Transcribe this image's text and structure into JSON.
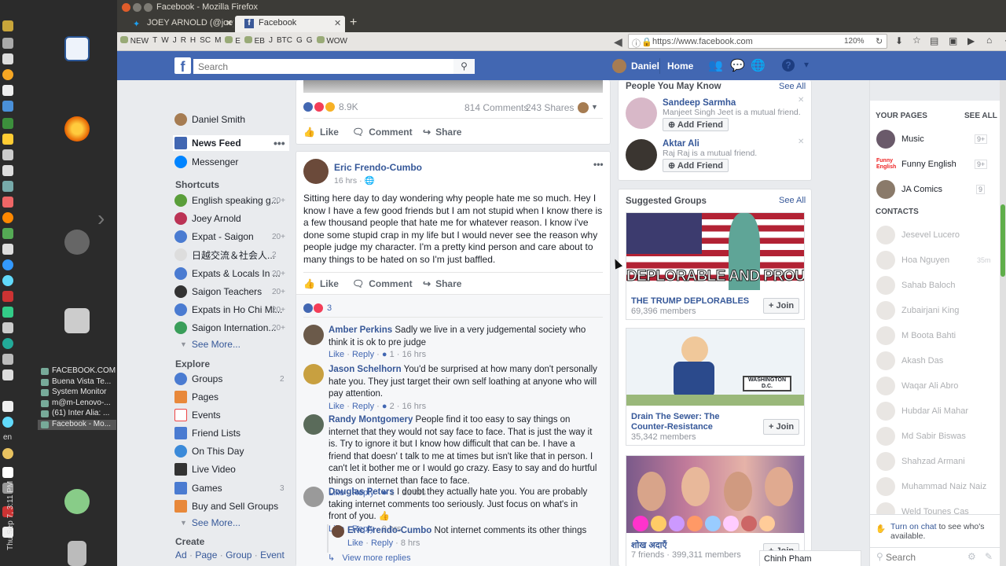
{
  "os": {
    "time": "Thu Sep 7, 3:11 PM",
    "lang": "en",
    "task_windows": [
      "FACEBOOK.COM",
      "Buena Vista Te...",
      "System Monitor",
      "m@m-Lenovo-...",
      "(61) Inter Alia: ...",
      "Facebook - Mo..."
    ]
  },
  "browser": {
    "title": "Facebook - Mozilla Firefox",
    "tabs": [
      {
        "label": "JOEY ARNOLD (@joey..."
      },
      {
        "label": "Facebook"
      }
    ],
    "new_tab": "+",
    "bookmarks": [
      "NEW",
      "T",
      "W",
      "J",
      "R",
      "H",
      "SC",
      "M",
      "E",
      "EB",
      "J",
      "BTC",
      "G",
      "G",
      "WOW"
    ],
    "url": "https://www.facebook.com",
    "zoom": "120%"
  },
  "fb": {
    "logo": "f",
    "search_placeholder": "Search",
    "user_first": "Daniel",
    "home": "Home"
  },
  "leftnav": {
    "user": "Daniel Smith",
    "news_feed": "News Feed",
    "messenger": "Messenger",
    "shortcuts_title": "Shortcuts",
    "shortcuts": [
      {
        "label": "English speaking g...",
        "count": "20+"
      },
      {
        "label": "Joey Arnold",
        "count": ""
      },
      {
        "label": "Expat - Saigon",
        "count": "20+"
      },
      {
        "label": "日越交流＆社会人...",
        "count": "2"
      },
      {
        "label": "Expats & Locals In ...",
        "count": "20+"
      },
      {
        "label": "Saigon Teachers",
        "count": "20+"
      },
      {
        "label": "Expats in Ho Chi Mi...",
        "count": "20+"
      },
      {
        "label": "Saigon Internation...",
        "count": "20+"
      }
    ],
    "see_more": "See More...",
    "explore_title": "Explore",
    "explore": [
      {
        "label": "Groups",
        "count": "2"
      },
      {
        "label": "Pages",
        "count": ""
      },
      {
        "label": "Events",
        "count": ""
      },
      {
        "label": "Friend Lists",
        "count": ""
      },
      {
        "label": "On This Day",
        "count": ""
      },
      {
        "label": "Live Video",
        "count": ""
      },
      {
        "label": "Games",
        "count": "3"
      },
      {
        "label": "Buy and Sell Groups",
        "count": ""
      }
    ],
    "see_more2": "See More...",
    "create_title": "Create",
    "create_links": [
      "Ad",
      "Page",
      "Group",
      "Event"
    ]
  },
  "post_prev": {
    "reactions": "8.9K",
    "comments": "814 Comments",
    "shares": "243 Shares",
    "like": "Like",
    "comment": "Comment",
    "share": "Share"
  },
  "post": {
    "author": "Eric Frendo-Cumbo",
    "time": "16 hrs",
    "text": "Sitting here day to day wondering why people hate me so much. Hey I know I have a few good friends but I am not stupid when I know there is a few thousand people that hate me for whatever reason. I know i've done some stupid crap in my life but I would never see the reason why people judge my character. I'm a pretty kind person and care about to many things to be hated on so I'm just baffled.",
    "like": "Like",
    "comment": "Comment",
    "share": "Share",
    "reaction_count": "3",
    "comments": [
      {
        "name": "Amber Perkins",
        "text": "Sadly we live in a very judgemental society who think it is ok to pre judge",
        "like": "Like",
        "reply": "Reply",
        "react": "1",
        "time": "16 hrs"
      },
      {
        "name": "Jason Schelhorn",
        "text": "You'd be surprised at how many don't personally hate you. They just target their own self loathing at anyone who will pay attention.",
        "like": "Like",
        "reply": "Reply",
        "react": "2",
        "time": "16 hrs"
      },
      {
        "name": "Randy Montgomery",
        "text": "People find it too easy to say things on internet that they would not say face to face. That is just the way it is. Try to ignore it but I know how difficult that can be. I have a friend that doesn' t talk to me at times but isn't like that in person. I can't let it bother me or I would go crazy. Easy to say and do hurtful things on internet than face to face.",
        "like": "Like",
        "reply": "Reply",
        "react": "1",
        "time": "13 hrs"
      },
      {
        "name": "Douglas Peters",
        "text": "I doubt they actually hate you. You are probably taking internet comments too seriously. Just focus on what's in front of you. 👍",
        "like": "Like",
        "reply": "Reply",
        "react": "",
        "time": "9 hrs"
      }
    ],
    "reply": {
      "name": "Eric Frendo-Cumbo",
      "text": "Not internet comments its other things",
      "like": "Like",
      "reply": "Reply",
      "time": "8 hrs"
    },
    "view_more": "View more replies"
  },
  "pymk": {
    "title": "People You May Know",
    "see_all": "See All",
    "people": [
      {
        "name": "Sandeep Sarmha",
        "mutual": "Manjeet Singh Jeet is a mutual friend.",
        "btn": "Add Friend"
      },
      {
        "name": "Aktar Ali",
        "mutual": "Raj Raj is a mutual friend.",
        "btn": "Add Friend"
      }
    ]
  },
  "groups": {
    "title": "Suggested Groups",
    "see_all": "See All",
    "items": [
      {
        "img_text": "DEPLORABLE AND PROUD",
        "name": "THE TRUMP DEPLORABLES",
        "members": "69,396 members",
        "join": "Join"
      },
      {
        "img_text": "WASHINGTON D.C.",
        "name": "Drain The Sewer: The Counter-Resistance",
        "members": "35,342 members",
        "join": "Join"
      },
      {
        "img_text": "",
        "name": "शोख अदाएँ",
        "members": "7 friends · 399,311 members",
        "join": "Join"
      }
    ]
  },
  "sidebar": {
    "your_pages": "YOUR PAGES",
    "see_all": "SEE ALL",
    "pages": [
      {
        "name": "Music",
        "badge": "9+"
      },
      {
        "name": "Funny English",
        "badge": "9+"
      },
      {
        "name": "JA Comics",
        "badge": "9"
      }
    ],
    "funny_logo": "Funny English",
    "contacts_title": "CONTACTS",
    "contacts": [
      "Jesevel Lucero",
      "Hoa Nguyen",
      "Sahab Baloch",
      "Zubairjani King",
      "M Boota Bahti",
      "Akash Das",
      "Waqar Ali Abro",
      "Hubdar Ali Mahar",
      "Md Sabir Biswas",
      "Shahzad Armani",
      "Muhammad Naiz Naiz",
      "Weld Tounes Cas"
    ],
    "hoa_time": "35m",
    "turn_on_chat": "Turn on chat",
    "chat_note": "to see who's available.",
    "search_placeholder": "Search",
    "chat_tab": "Chinh Pham"
  }
}
